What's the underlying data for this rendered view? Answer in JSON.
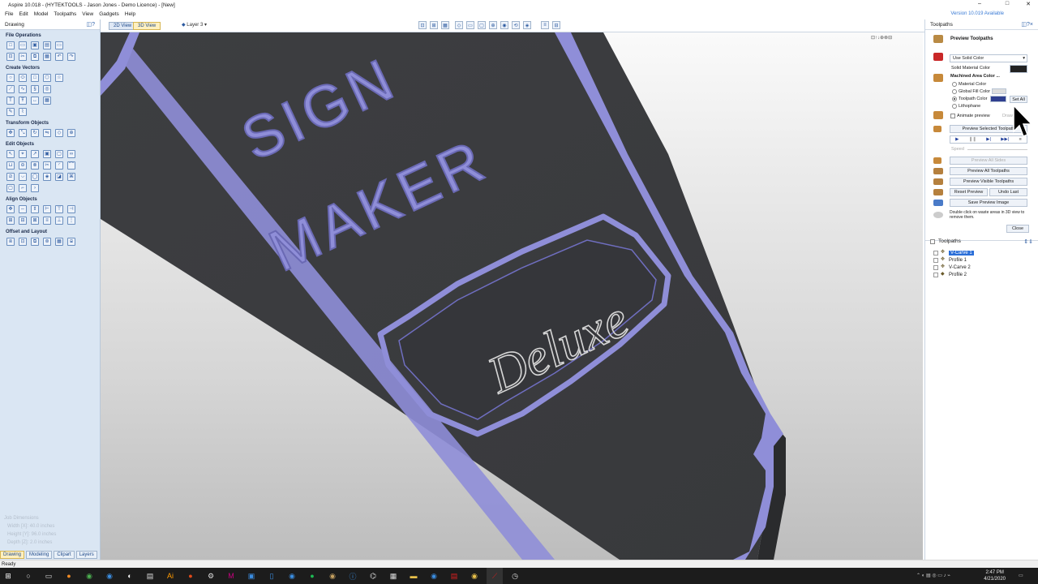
{
  "window": {
    "title": "Aspire 10.018 - (HYTEKTOOLS - Jason Jones - Demo Licence) - [New]",
    "minimize": "–",
    "maximize": "□",
    "close": "✕"
  },
  "menu": [
    "File",
    "Edit",
    "Model",
    "Toolpaths",
    "View",
    "Gadgets",
    "Help"
  ],
  "version_notice": "Version 10.019 Available",
  "left_panel": {
    "header": "Drawing",
    "sections": {
      "file_operations": "File Operations",
      "create_vectors": "Create Vectors",
      "transform_objects": "Transform Objects",
      "edit_objects": "Edit Objects",
      "align_objects": "Align Objects",
      "offset_layout": "Offset and Layout"
    },
    "job_dimensions": {
      "title": "Job Dimensions",
      "width": "Width  [X]: 40.0 inches",
      "height": "Height [Y]: 96.0 inches",
      "depth": "Depth  [Z]: 2.0 inches"
    },
    "tabs": [
      "Drawing",
      "Modeling",
      "Clipart",
      "Layers"
    ]
  },
  "view_tabs": {
    "tab_2d": "2D View",
    "tab_3d": "3D View",
    "layer": "Layer 3"
  },
  "viewport": {
    "text_sign": "SIGN",
    "text_maker": "MAKER",
    "text_deluxe": "Deluxe",
    "colors": {
      "board": "#3b3c3f",
      "board_side": "#2a2b2d",
      "carve": "#8f8ed8",
      "deluxe": "#d6d6d6"
    }
  },
  "right_panel": {
    "header": "Toolpaths",
    "preview": {
      "title": "Preview Toolpaths",
      "solid_color_select": "Use Solid Color",
      "solid_material_color": "Solid Material Color",
      "machined_area_color": "Machined Area Color ...",
      "material_color": "Material Color",
      "global_fill_color": "Global Fill Color",
      "toolpath_color": "Toolpath Color",
      "set_all": "Set All",
      "lithophane": "Lithophane",
      "animate_preview": "Animate preview",
      "draw": "Draw",
      "preview_selected": "Preview Selected Toolpath",
      "speed": "Speed",
      "preview_all_sides": "Preview All Sides",
      "preview_all": "Preview All Toolpaths",
      "preview_visible": "Preview Visible Toolpaths",
      "reset_preview": "Reset Preview",
      "undo_last": "Undo Last",
      "save_image": "Save Preview Image",
      "hint": "Double click on waste areas in 3D view to remove them.",
      "close": "Close",
      "swatch_colors": {
        "solid": "#c92828",
        "toolpath": "#2f3f8f",
        "material": "#c7893a"
      }
    },
    "toolpaths": {
      "title": "Toolpaths",
      "items": [
        "V-Carve 1",
        "Profile 1",
        "V-Carve 2",
        "Profile 2"
      ]
    }
  },
  "status": "Ready",
  "taskbar": {
    "time": "2:47 PM",
    "date": "4/21/2020"
  }
}
